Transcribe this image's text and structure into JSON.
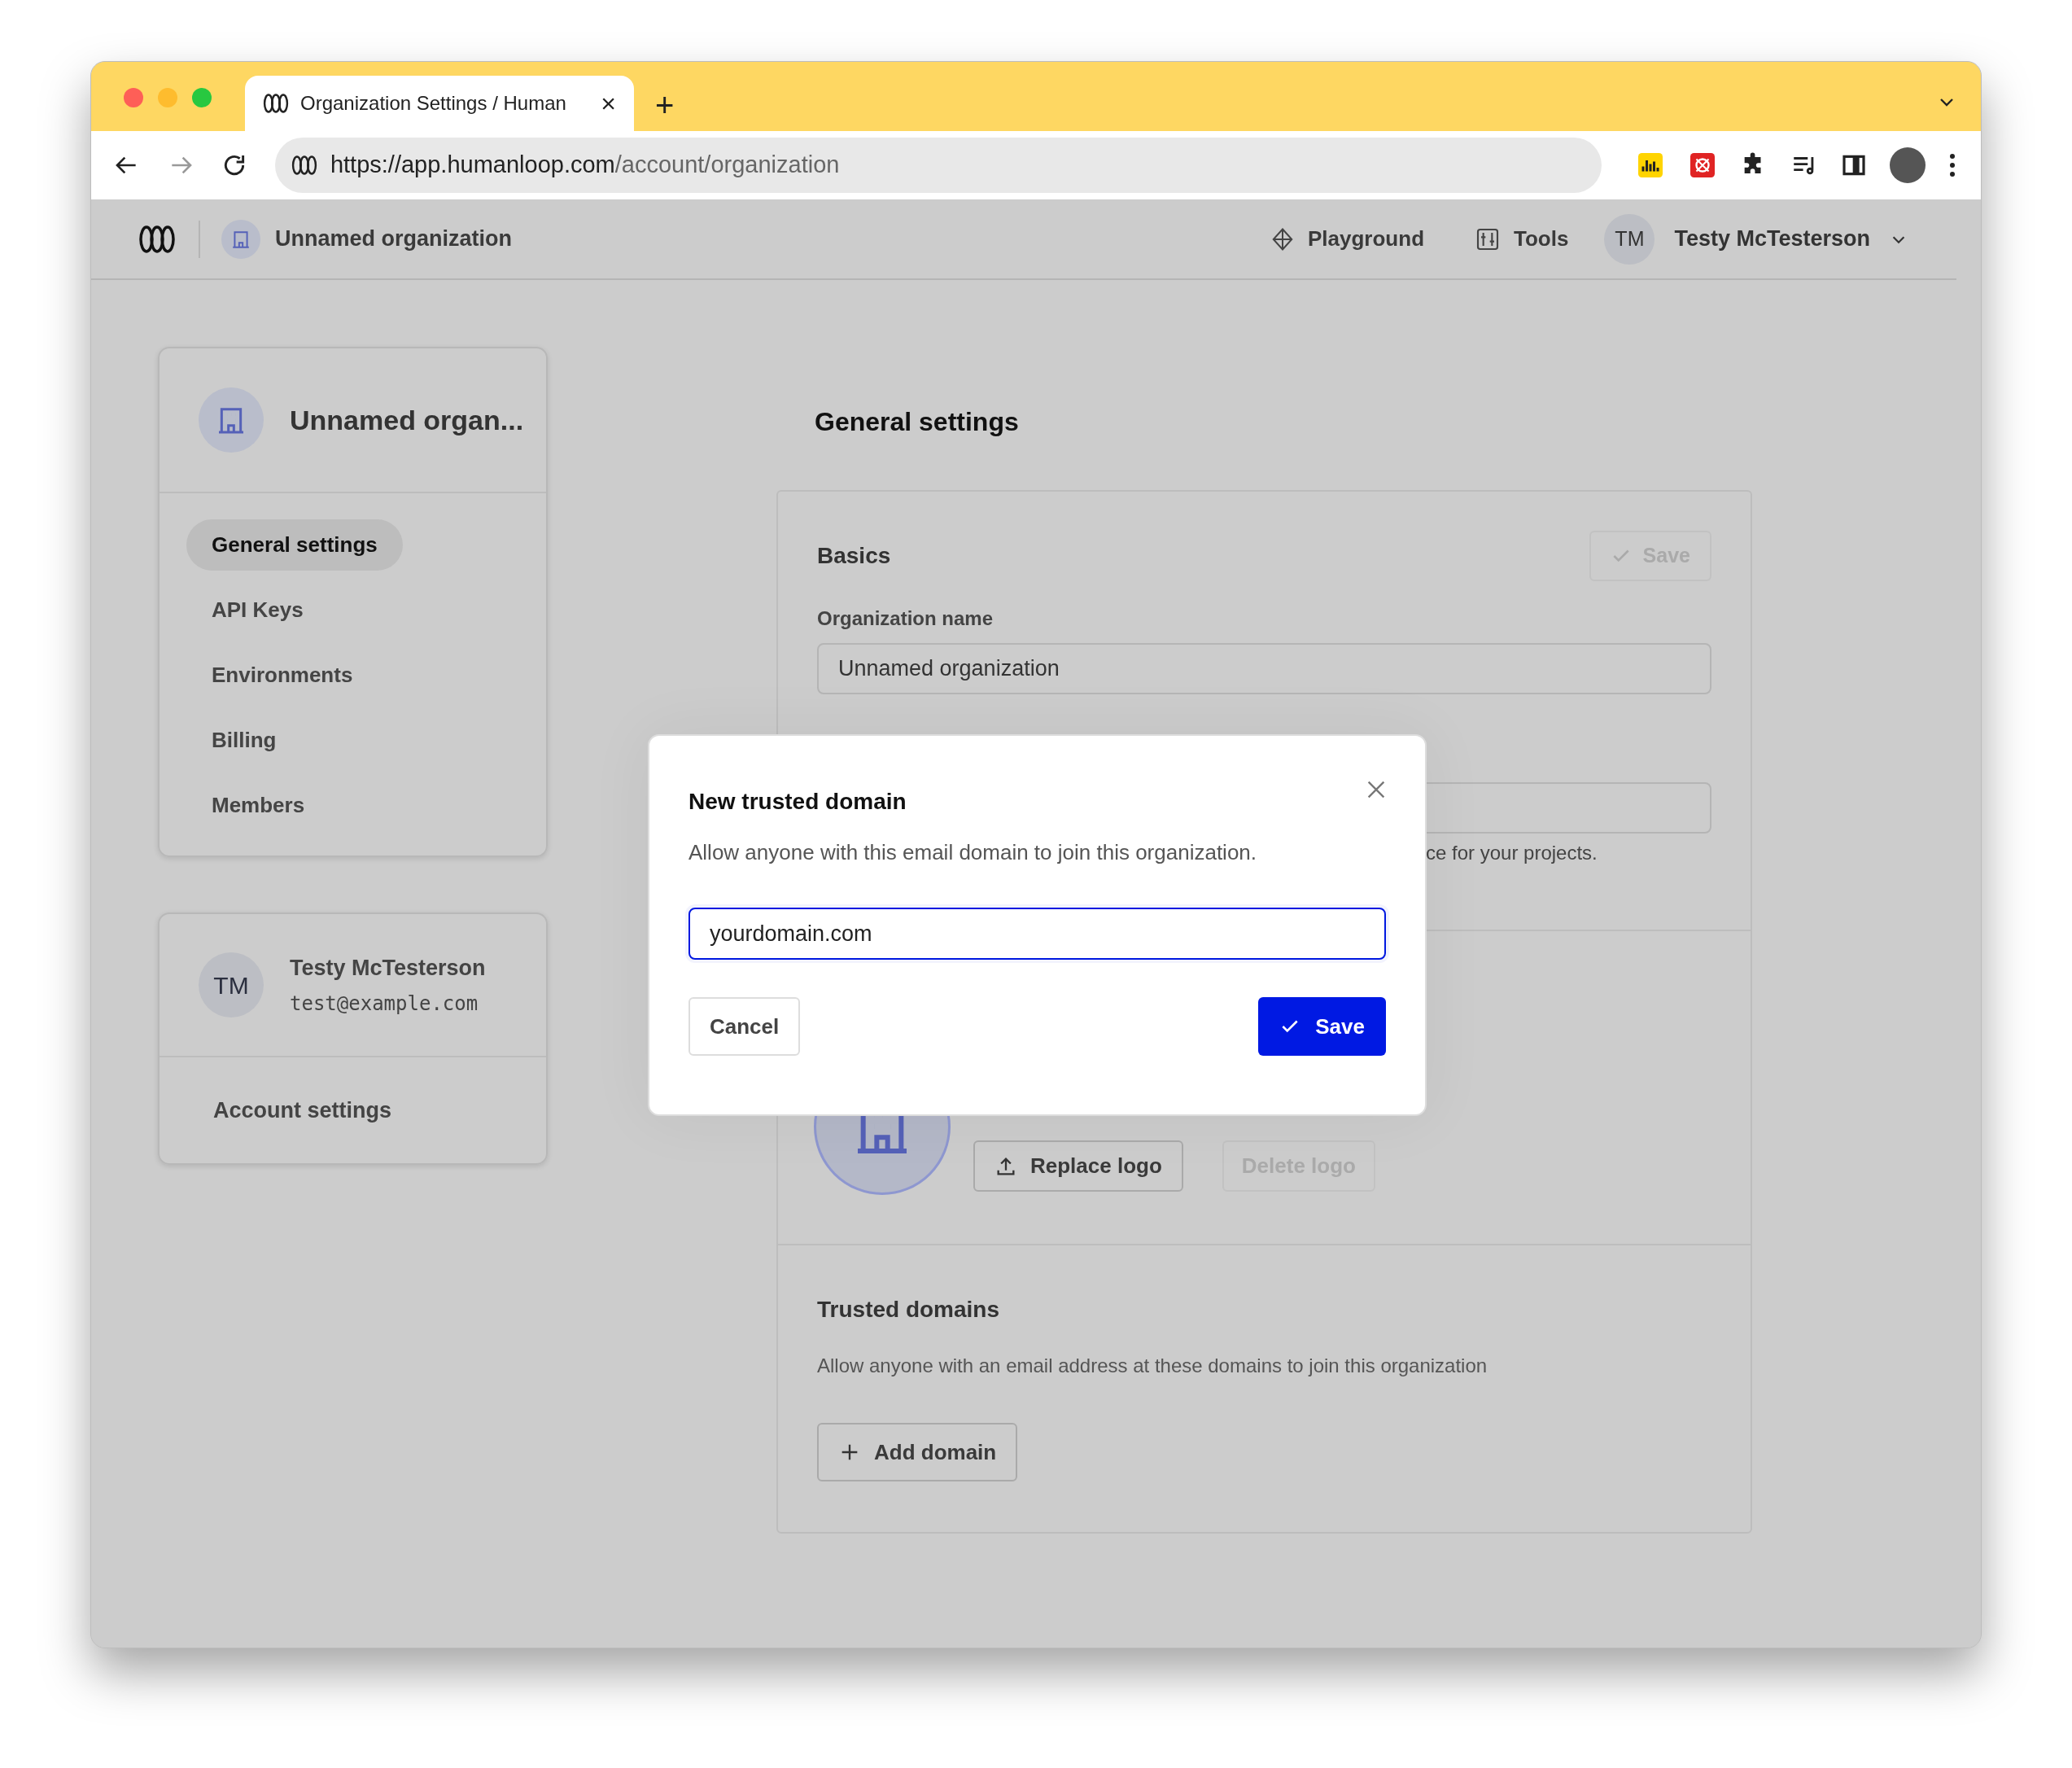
{
  "browser": {
    "tab_title": "Organization Settings / Human",
    "tab_close": "×",
    "new_tab": "+",
    "url_host": "https://app.humanloop.com",
    "url_path": "/account/organization"
  },
  "header": {
    "org": "Unnamed organization",
    "nav": [
      {
        "label": "Playground",
        "kind": "playground"
      },
      {
        "label": "Tools",
        "kind": "tools"
      }
    ],
    "user": {
      "initials": "TM",
      "name": "Testy McTesterson"
    }
  },
  "sidebar": {
    "org_name": "Unnamed organ...",
    "items": [
      {
        "label": "General settings",
        "selected": true
      },
      {
        "label": "API Keys",
        "selected": false
      },
      {
        "label": "Environments",
        "selected": false
      },
      {
        "label": "Billing",
        "selected": false
      },
      {
        "label": "Members",
        "selected": false
      }
    ],
    "user": {
      "initials": "TM",
      "name": "Testy McTesterson",
      "email": "test@example.com"
    },
    "account_link": "Account settings"
  },
  "page": {
    "title": "General settings",
    "basics": {
      "heading": "Basics",
      "save": "Save",
      "save_disabled": true,
      "name_label": "Organization name",
      "name_value": "Unnamed organization",
      "helper_fragment": "ce for your projects."
    },
    "logo": {
      "replace": "Replace logo",
      "delete": "Delete logo",
      "delete_disabled": true
    },
    "trusted": {
      "heading": "Trusted domains",
      "description": "Allow anyone with an email address at these domains to join this organization",
      "add": "Add domain"
    }
  },
  "dialog": {
    "title": "New trusted domain",
    "description": "Allow anyone with this email domain to join this organization.",
    "input_value": "yourdomain.com",
    "cancel": "Cancel",
    "save": "Save"
  }
}
